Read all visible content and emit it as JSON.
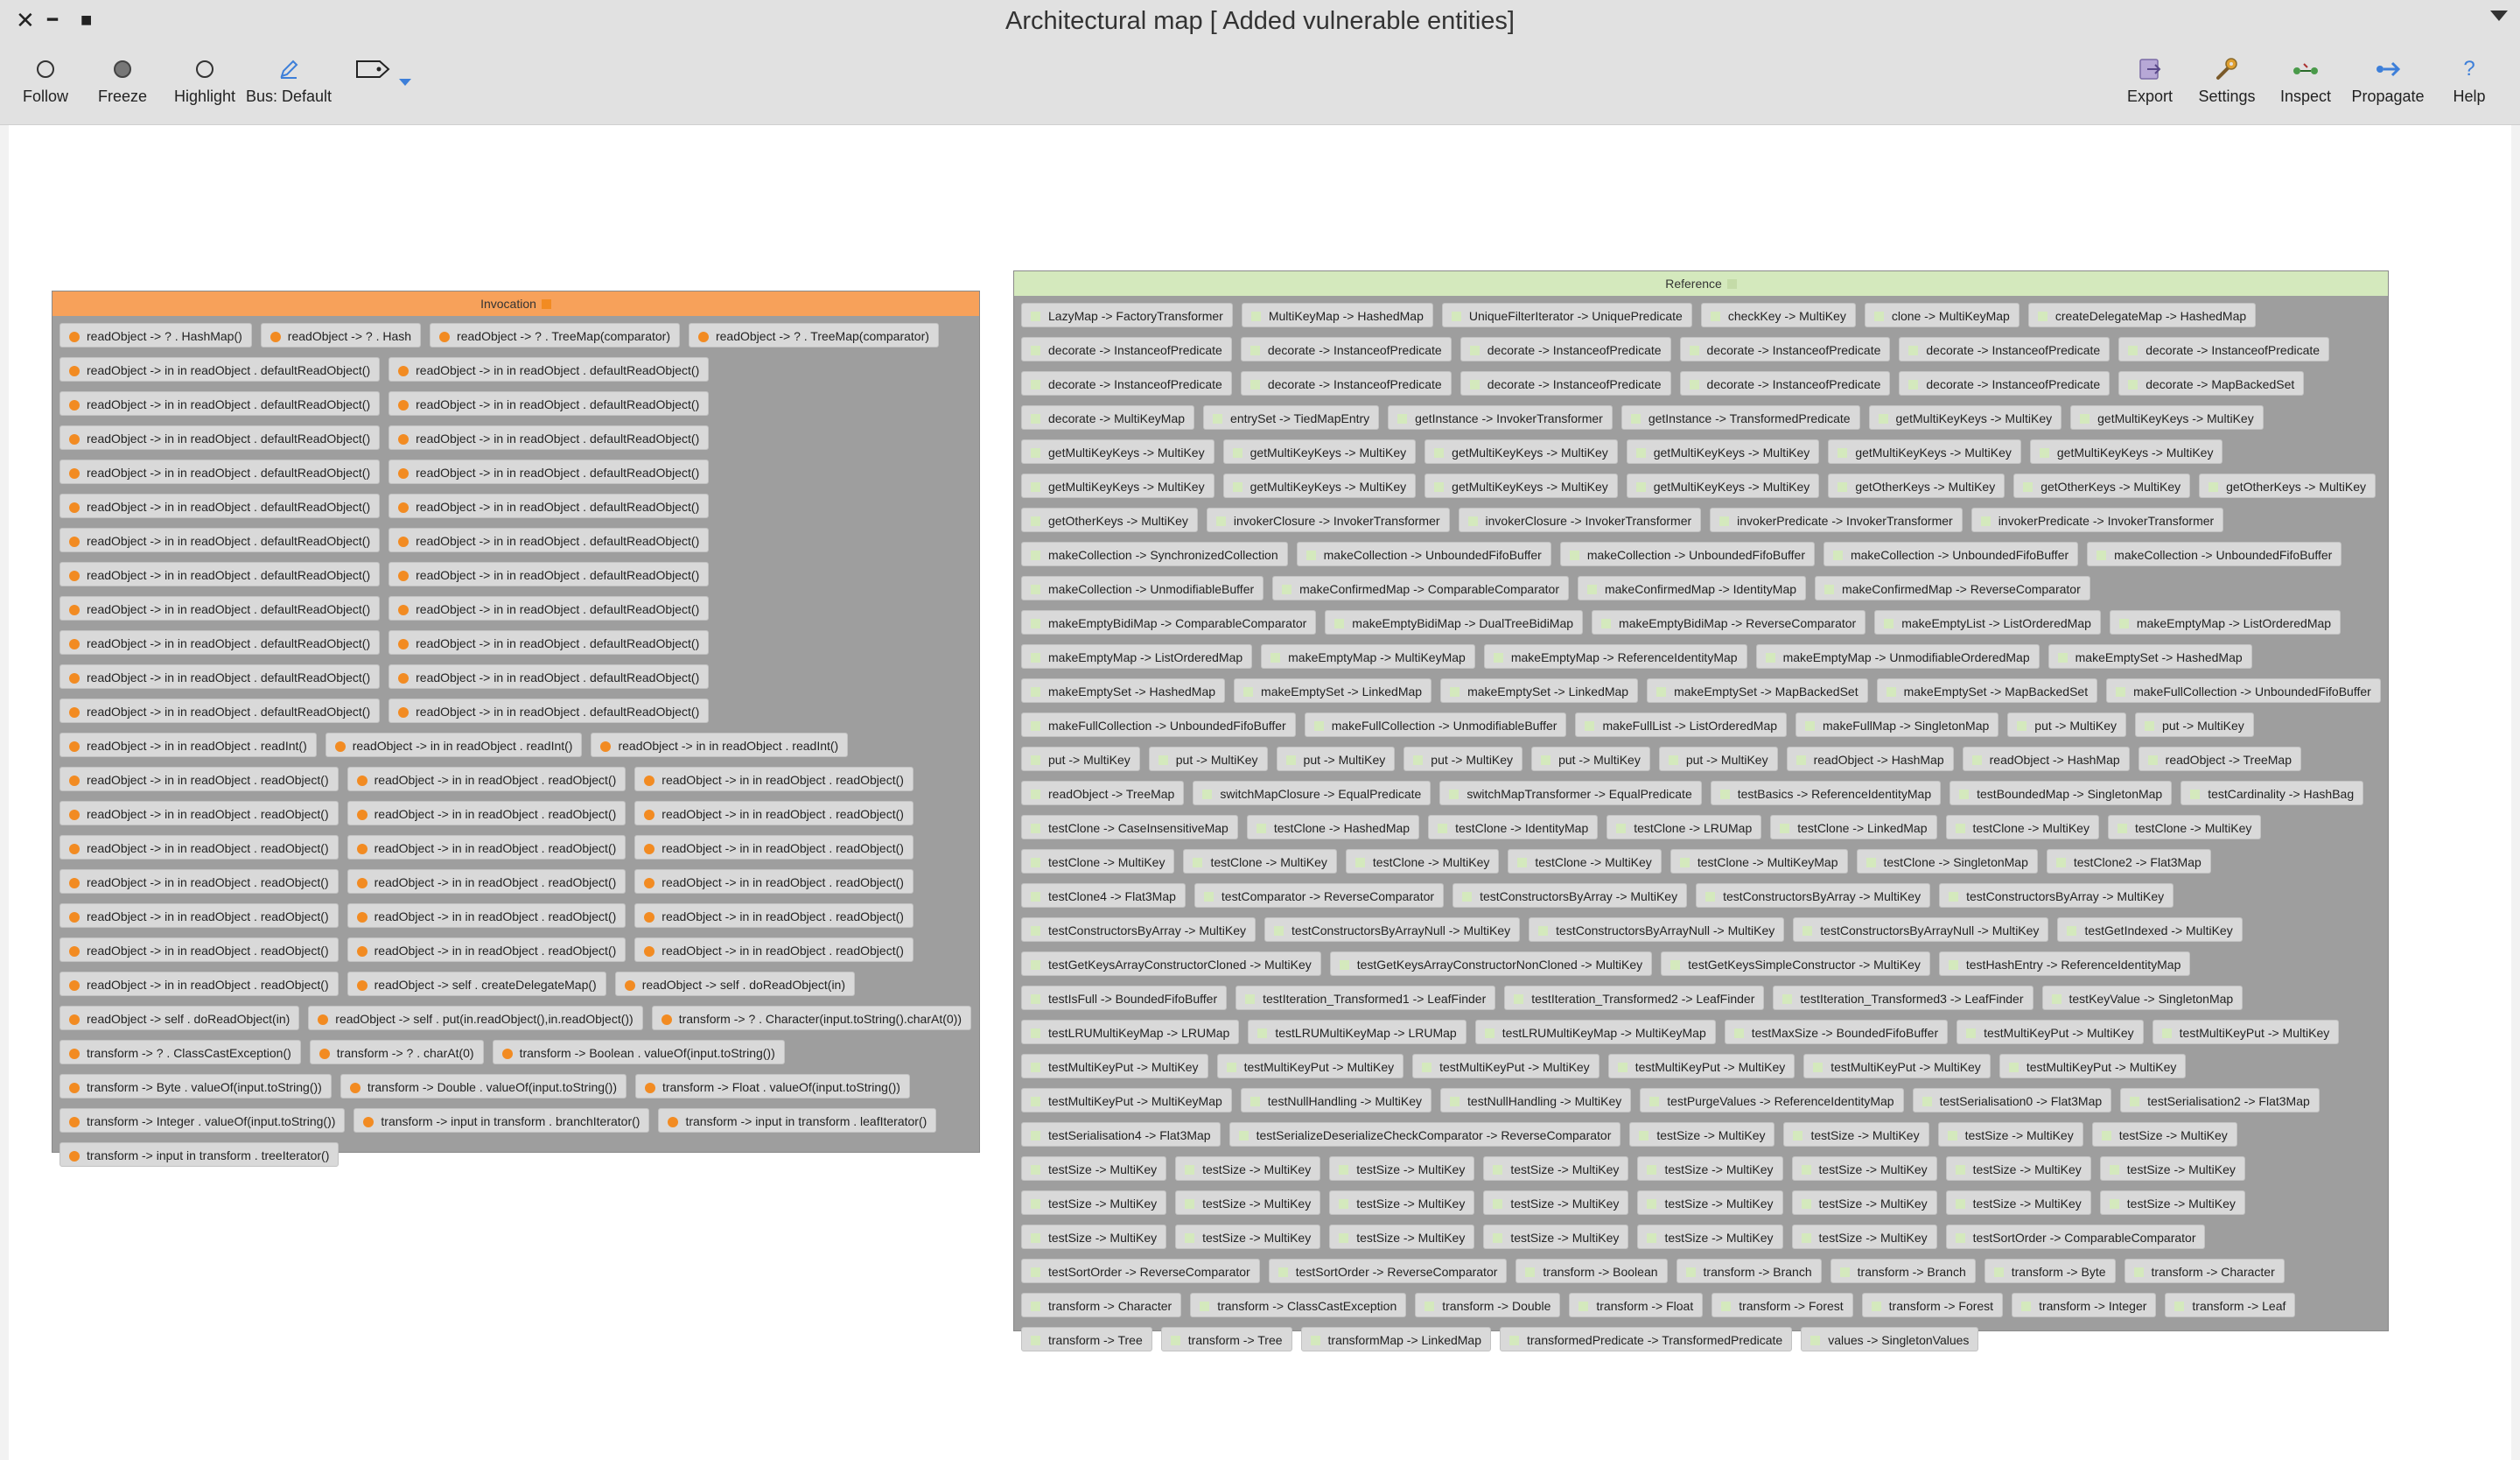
{
  "window": {
    "title": "Architectural map [ Added vulnerable entities]",
    "close_glyph": "✕",
    "minimize_glyph": "━",
    "maximize_glyph": "■"
  },
  "toolbar": {
    "left": [
      {
        "label": "Follow",
        "icon": "hollow-circle-icon"
      },
      {
        "label": "Freeze",
        "icon": "filled-circle-icon"
      },
      {
        "label": "Highlight",
        "icon": "hollow-circle-icon"
      },
      {
        "label": "Bus: Default",
        "icon": "pen-icon"
      },
      {
        "label": "",
        "icon": "tag-icon"
      }
    ],
    "right": [
      {
        "label": "Export",
        "icon": "export-icon"
      },
      {
        "label": "Settings",
        "icon": "wrench-icon"
      },
      {
        "label": "Inspect",
        "icon": "inspect-icon"
      },
      {
        "label": "Propagate",
        "icon": "arrow-right-icon"
      },
      {
        "label": "Help",
        "icon": "help-icon"
      }
    ]
  },
  "colors": {
    "invocation_header": "#f7a15a",
    "invocation_dot": "#f28b22",
    "reference_header": "#d4e9bd",
    "group_body": "#9e9e9e"
  },
  "invocation": {
    "title": "Invocation",
    "items": [
      "readObject -> ? . HashMap()",
      "readObject -> ? . Hash",
      "readObject -> ? . TreeMap(comparator)",
      "readObject -> ? . TreeMap(comparator)",
      "readObject -> in in readObject . defaultReadObject()",
      "readObject -> in in readObject . defaultReadObject()",
      "readObject -> in in readObject . defaultReadObject()",
      "readObject -> in in readObject . defaultReadObject()",
      "readObject -> in in readObject . defaultReadObject()",
      "readObject -> in in readObject . defaultReadObject()",
      "readObject -> in in readObject . defaultReadObject()",
      "readObject -> in in readObject . defaultReadObject()",
      "readObject -> in in readObject . defaultReadObject()",
      "readObject -> in in readObject . defaultReadObject()",
      "readObject -> in in readObject . defaultReadObject()",
      "readObject -> in in readObject . defaultReadObject()",
      "readObject -> in in readObject . defaultReadObject()",
      "readObject -> in in readObject . defaultReadObject()",
      "readObject -> in in readObject . defaultReadObject()",
      "readObject -> in in readObject . defaultReadObject()",
      "readObject -> in in readObject . defaultReadObject()",
      "readObject -> in in readObject . defaultReadObject()",
      "readObject -> in in readObject . defaultReadObject()",
      "readObject -> in in readObject . defaultReadObject()",
      "readObject -> in in readObject . defaultReadObject()",
      "readObject -> in in readObject . defaultReadObject()",
      "readObject -> in in readObject . readInt()",
      "readObject -> in in readObject . readInt()",
      "readObject -> in in readObject . readInt()",
      "readObject -> in in readObject . readObject()",
      "readObject -> in in readObject . readObject()",
      "readObject -> in in readObject . readObject()",
      "readObject -> in in readObject . readObject()",
      "readObject -> in in readObject . readObject()",
      "readObject -> in in readObject . readObject()",
      "readObject -> in in readObject . readObject()",
      "readObject -> in in readObject . readObject()",
      "readObject -> in in readObject . readObject()",
      "readObject -> in in readObject . readObject()",
      "readObject -> in in readObject . readObject()",
      "readObject -> in in readObject . readObject()",
      "readObject -> in in readObject . readObject()",
      "readObject -> in in readObject . readObject()",
      "readObject -> in in readObject . readObject()",
      "readObject -> in in readObject . readObject()",
      "readObject -> in in readObject . readObject()",
      "readObject -> in in readObject . readObject()",
      "readObject -> in in readObject . readObject()",
      "readObject -> self . createDelegateMap()",
      "readObject -> self . doReadObject(in)",
      "readObject -> self . doReadObject(in)",
      "readObject -> self . put(in.readObject(),in.readObject())",
      "transform -> ? . Character(input.toString().charAt(0))",
      "transform -> ? . ClassCastException()",
      "transform -> ? . charAt(0)",
      "transform -> Boolean . valueOf(input.toString())",
      "transform -> Byte . valueOf(input.toString())",
      "transform -> Double . valueOf(input.toString())",
      "transform -> Float . valueOf(input.toString())",
      "transform -> Integer . valueOf(input.toString())",
      "transform -> input in transform . branchIterator()",
      "transform -> input in transform . leafIterator()",
      "transform -> input in transform . treeIterator()"
    ]
  },
  "reference": {
    "title": "Reference",
    "items": [
      "LazyMap -> FactoryTransformer",
      "MultiKeyMap -> HashedMap",
      "UniqueFilterIterator -> UniquePredicate",
      "checkKey -> MultiKey",
      "clone -> MultiKeyMap",
      "createDelegateMap -> HashedMap",
      "decorate -> InstanceofPredicate",
      "decorate -> InstanceofPredicate",
      "decorate -> InstanceofPredicate",
      "decorate -> InstanceofPredicate",
      "decorate -> InstanceofPredicate",
      "decorate -> InstanceofPredicate",
      "decorate -> InstanceofPredicate",
      "decorate -> InstanceofPredicate",
      "decorate -> InstanceofPredicate",
      "decorate -> InstanceofPredicate",
      "decorate -> InstanceofPredicate",
      "decorate -> MapBackedSet",
      "decorate -> MultiKeyMap",
      "entrySet -> TiedMapEntry",
      "getInstance -> InvokerTransformer",
      "getInstance -> TransformedPredicate",
      "getMultiKeyKeys -> MultiKey",
      "getMultiKeyKeys -> MultiKey",
      "getMultiKeyKeys -> MultiKey",
      "getMultiKeyKeys -> MultiKey",
      "getMultiKeyKeys -> MultiKey",
      "getMultiKeyKeys -> MultiKey",
      "getMultiKeyKeys -> MultiKey",
      "getMultiKeyKeys -> MultiKey",
      "getMultiKeyKeys -> MultiKey",
      "getMultiKeyKeys -> MultiKey",
      "getMultiKeyKeys -> MultiKey",
      "getMultiKeyKeys -> MultiKey",
      "getOtherKeys -> MultiKey",
      "getOtherKeys -> MultiKey",
      "getOtherKeys -> MultiKey",
      "getOtherKeys -> MultiKey",
      "invokerClosure -> InvokerTransformer",
      "invokerClosure -> InvokerTransformer",
      "invokerPredicate -> InvokerTransformer",
      "invokerPredicate -> InvokerTransformer",
      "makeCollection -> SynchronizedCollection",
      "makeCollection -> UnboundedFifoBuffer",
      "makeCollection -> UnboundedFifoBuffer",
      "makeCollection -> UnboundedFifoBuffer",
      "makeCollection -> UnboundedFifoBuffer",
      "makeCollection -> UnmodifiableBuffer",
      "makeConfirmedMap -> ComparableComparator",
      "makeConfirmedMap -> IdentityMap",
      "makeConfirmedMap -> ReverseComparator",
      "makeEmptyBidiMap -> ComparableComparator",
      "makeEmptyBidiMap -> DualTreeBidiMap",
      "makeEmptyBidiMap -> ReverseComparator",
      "makeEmptyList -> ListOrderedMap",
      "makeEmptyMap -> ListOrderedMap",
      "makeEmptyMap -> ListOrderedMap",
      "makeEmptyMap -> MultiKeyMap",
      "makeEmptyMap -> ReferenceIdentityMap",
      "makeEmptyMap -> UnmodifiableOrderedMap",
      "makeEmptySet -> HashedMap",
      "makeEmptySet -> HashedMap",
      "makeEmptySet -> LinkedMap",
      "makeEmptySet -> LinkedMap",
      "makeEmptySet -> MapBackedSet",
      "makeEmptySet -> MapBackedSet",
      "makeFullCollection -> UnboundedFifoBuffer",
      "makeFullCollection -> UnboundedFifoBuffer",
      "makeFullCollection -> UnmodifiableBuffer",
      "makeFullList -> ListOrderedMap",
      "makeFullMap -> SingletonMap",
      "put -> MultiKey",
      "put -> MultiKey",
      "put -> MultiKey",
      "put -> MultiKey",
      "put -> MultiKey",
      "put -> MultiKey",
      "put -> MultiKey",
      "put -> MultiKey",
      "readObject -> HashMap",
      "readObject -> HashMap",
      "readObject -> TreeMap",
      "readObject -> TreeMap",
      "switchMapClosure -> EqualPredicate",
      "switchMapTransformer -> EqualPredicate",
      "testBasics -> ReferenceIdentityMap",
      "testBoundedMap -> SingletonMap",
      "testCardinality -> HashBag",
      "testClone -> CaseInsensitiveMap",
      "testClone -> HashedMap",
      "testClone -> IdentityMap",
      "testClone -> LRUMap",
      "testClone -> LinkedMap",
      "testClone -> MultiKey",
      "testClone -> MultiKey",
      "testClone -> MultiKey",
      "testClone -> MultiKey",
      "testClone -> MultiKey",
      "testClone -> MultiKey",
      "testClone -> MultiKeyMap",
      "testClone -> SingletonMap",
      "testClone2 -> Flat3Map",
      "testClone4 -> Flat3Map",
      "testComparator -> ReverseComparator",
      "testConstructorsByArray -> MultiKey",
      "testConstructorsByArray -> MultiKey",
      "testConstructorsByArray -> MultiKey",
      "testConstructorsByArray -> MultiKey",
      "testConstructorsByArrayNull -> MultiKey",
      "testConstructorsByArrayNull -> MultiKey",
      "testConstructorsByArrayNull -> MultiKey",
      "testGetIndexed -> MultiKey",
      "testGetKeysArrayConstructorCloned -> MultiKey",
      "testGetKeysArrayConstructorNonCloned -> MultiKey",
      "testGetKeysSimpleConstructor -> MultiKey",
      "testHashEntry -> ReferenceIdentityMap",
      "testIsFull -> BoundedFifoBuffer",
      "testIteration_Transformed1 -> LeafFinder",
      "testIteration_Transformed2 -> LeafFinder",
      "testIteration_Transformed3 -> LeafFinder",
      "testKeyValue -> SingletonMap",
      "testLRUMultiKeyMap -> LRUMap",
      "testLRUMultiKeyMap -> LRUMap",
      "testLRUMultiKeyMap -> MultiKeyMap",
      "testMaxSize -> BoundedFifoBuffer",
      "testMultiKeyPut -> MultiKey",
      "testMultiKeyPut -> MultiKey",
      "testMultiKeyPut -> MultiKey",
      "testMultiKeyPut -> MultiKey",
      "testMultiKeyPut -> MultiKey",
      "testMultiKeyPut -> MultiKey",
      "testMultiKeyPut -> MultiKey",
      "testMultiKeyPut -> MultiKey",
      "testMultiKeyPut -> MultiKeyMap",
      "testNullHandling -> MultiKey",
      "testNullHandling -> MultiKey",
      "testPurgeValues -> ReferenceIdentityMap",
      "testSerialisation0 -> Flat3Map",
      "testSerialisation2 -> Flat3Map",
      "testSerialisation4 -> Flat3Map",
      "testSerializeDeserializeCheckComparator -> ReverseComparator",
      "testSize -> MultiKey",
      "testSize -> MultiKey",
      "testSize -> MultiKey",
      "testSize -> MultiKey",
      "testSize -> MultiKey",
      "testSize -> MultiKey",
      "testSize -> MultiKey",
      "testSize -> MultiKey",
      "testSize -> MultiKey",
      "testSize -> MultiKey",
      "testSize -> MultiKey",
      "testSize -> MultiKey",
      "testSize -> MultiKey",
      "testSize -> MultiKey",
      "testSize -> MultiKey",
      "testSize -> MultiKey",
      "testSize -> MultiKey",
      "testSize -> MultiKey",
      "testSize -> MultiKey",
      "testSize -> MultiKey",
      "testSize -> MultiKey",
      "testSize -> MultiKey",
      "testSize -> MultiKey",
      "testSize -> MultiKey",
      "testSize -> MultiKey",
      "testSize -> MultiKey",
      "testSortOrder -> ComparableComparator",
      "testSortOrder -> ReverseComparator",
      "testSortOrder -> ReverseComparator",
      "transform -> Boolean",
      "transform -> Branch",
      "transform -> Branch",
      "transform -> Byte",
      "transform -> Character",
      "transform -> Character",
      "transform -> ClassCastException",
      "transform -> Double",
      "transform -> Float",
      "transform -> Forest",
      "transform -> Forest",
      "transform -> Integer",
      "transform -> Leaf",
      "transform -> Tree",
      "transform -> Tree",
      "transformMap -> LinkedMap",
      "transformedPredicate -> TransformedPredicate",
      "values -> SingletonValues"
    ]
  }
}
